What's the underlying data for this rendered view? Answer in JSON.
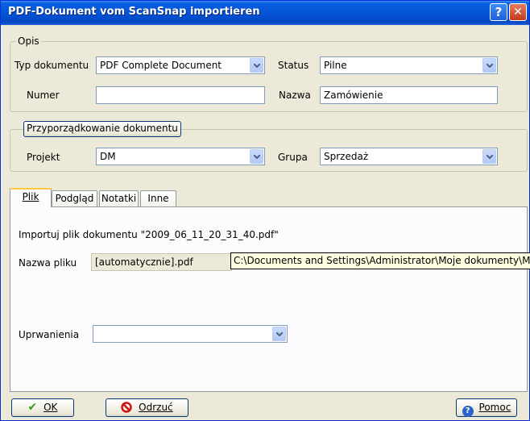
{
  "window": {
    "title": "PDF-Dokument vom ScanSnap importieren",
    "help_btn": "?",
    "close_btn": "✕"
  },
  "opis": {
    "legend": "Opis",
    "typ_label": "Typ dokumentu",
    "typ_value": "PDF Complete Document",
    "status_label": "Status",
    "status_value": "Pilne",
    "numer_label": "Numer",
    "numer_value": "",
    "nazwa_label": "Nazwa",
    "nazwa_value": "Zamówienie"
  },
  "assign": {
    "button_label": "Przyporządkowanie dokumentu",
    "projekt_label": "Projekt",
    "projekt_value": "DM",
    "grupa_label": "Grupa",
    "grupa_value": "Sprzedaż"
  },
  "tabs": [
    "Plik",
    "Podgląd",
    "Notatki",
    "Inne"
  ],
  "plik": {
    "import_text": "Importuj plik dokumentu \"2009_06_11_20_31_40.pdf\"",
    "nazwa_pliku_label": "Nazwa pliku",
    "nazwa_pliku_value": "[automatycznie].pdf",
    "tooltip": "C:\\Documents and Settings\\Administrator\\Moje dokumenty\\Moje obrazy",
    "uprawnienia_label": "Uprwanienia",
    "uprawnienia_value": ""
  },
  "buttons": {
    "ok": "OK",
    "reject": "Odrzuć",
    "help": "Pomoc"
  },
  "colors": {
    "title_bar": "#0454d8",
    "tab_highlight": "#ffc73c",
    "tooltip_bg": "#ffffe1"
  }
}
